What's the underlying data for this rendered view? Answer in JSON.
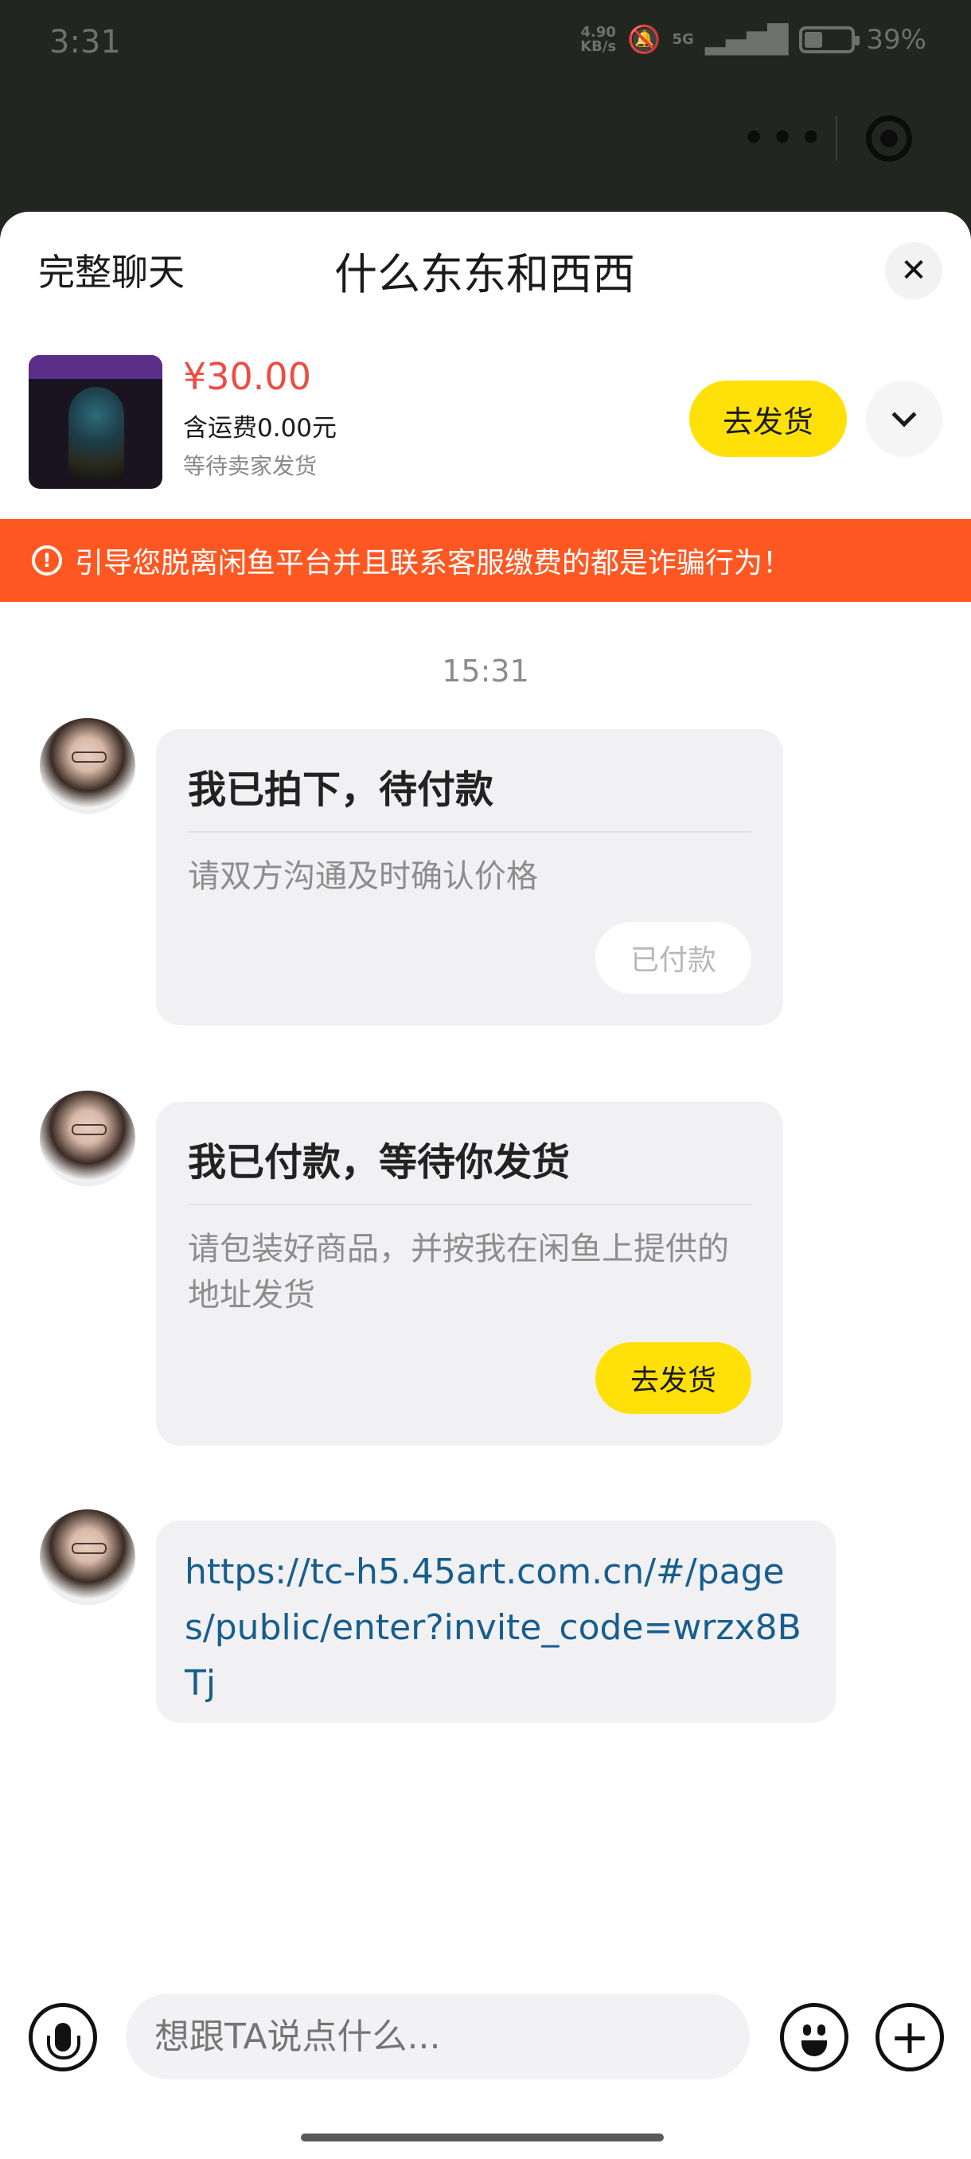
{
  "status_bar": {
    "time": "3:31",
    "net_speed_value": "4.90",
    "net_speed_unit": "KB/s",
    "signal": "5G",
    "battery_level": 0.39,
    "battery_percent": "39%"
  },
  "header": {
    "left_title": "完整聊天",
    "title": "什么东东和西西"
  },
  "product": {
    "price": "¥30.00",
    "shipping": "含运费0.00元",
    "status": "等待卖家发货",
    "ship_button": "去发货"
  },
  "warning": {
    "text": "引导您脱离闲鱼平台并且联系客服缴费的都是诈骗行为！"
  },
  "chat": {
    "timestamp": "15:31",
    "messages": [
      {
        "type": "card",
        "title": "我已拍下，待付款",
        "subtitle": "请双方沟通及时确认价格",
        "button": "已付款"
      },
      {
        "type": "card",
        "title": "我已付款，等待你发货",
        "subtitle": "请包装好商品，并按我在闲鱼上提供的地址发货",
        "button": "去发货"
      },
      {
        "type": "link",
        "text": "https://tc-h5.45art.com.cn/#/pages/public/enter?invite_code=wrzx8BTj"
      }
    ]
  },
  "composer": {
    "placeholder": "想跟TA说点什么..."
  },
  "colors": {
    "accent_yellow": "#ffe109",
    "warning_orange": "#ff5722",
    "price_red": "#ef4b43",
    "link_blue": "#175d8e"
  }
}
